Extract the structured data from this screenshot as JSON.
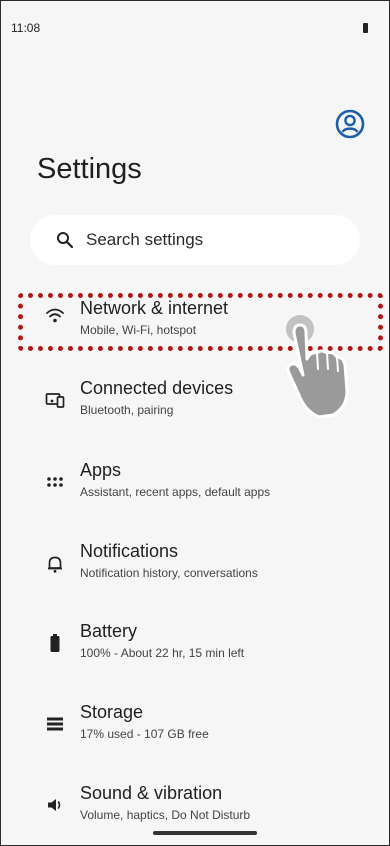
{
  "status_bar": {
    "time": "11:08"
  },
  "header": {
    "title": "Settings"
  },
  "search": {
    "placeholder": "Search settings"
  },
  "items": [
    {
      "icon": "wifi-icon",
      "title": "Network & internet",
      "subtitle": "Mobile, Wi-Fi, hotspot"
    },
    {
      "icon": "connected-devices-icon",
      "title": "Connected devices",
      "subtitle": "Bluetooth, pairing"
    },
    {
      "icon": "apps-grid-icon",
      "title": "Apps",
      "subtitle": "Assistant, recent apps, default apps"
    },
    {
      "icon": "bell-icon",
      "title": "Notifications",
      "subtitle": "Notification history, conversations"
    },
    {
      "icon": "battery-icon",
      "title": "Battery",
      "subtitle": "100% - About 22 hr, 15 min left"
    },
    {
      "icon": "storage-icon",
      "title": "Storage",
      "subtitle": "17% used - 107 GB free"
    },
    {
      "icon": "speaker-icon",
      "title": "Sound & vibration",
      "subtitle": "Volume, haptics, Do Not Disturb"
    }
  ],
  "colors": {
    "highlight": "#b01818",
    "background": "#f6f6f6",
    "search_background": "#ffffff"
  }
}
